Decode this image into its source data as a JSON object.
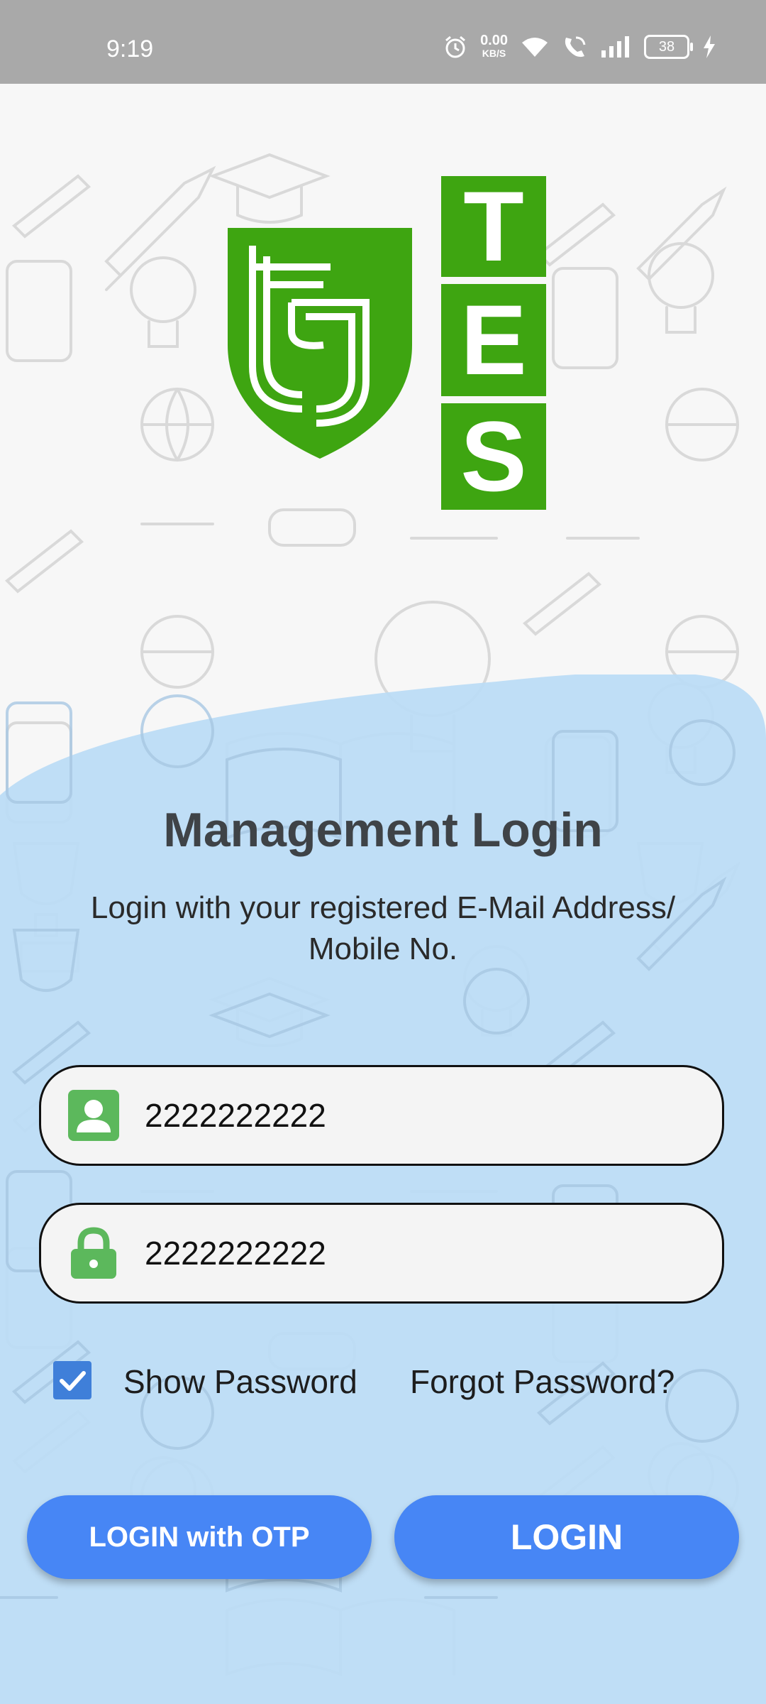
{
  "status_bar": {
    "time": "9:19",
    "net_speed_value": "0.00",
    "net_speed_unit": "KB/S",
    "battery": "38",
    "icons": [
      "alarm-icon",
      "wifi-icon",
      "wifi-call-icon",
      "signal-icon",
      "battery-icon",
      "charging-icon"
    ]
  },
  "logo": {
    "letters": [
      "T",
      "E",
      "S"
    ],
    "color": "#3ea511"
  },
  "login": {
    "title": "Management Login",
    "subtitle_line1": "Login with your registered E-Mail Address/",
    "subtitle_line2": "Mobile No.",
    "username_value": "2222222222",
    "password_value": "2222222222",
    "show_password_label": "Show Password",
    "show_password_checked": true,
    "forgot_password_label": "Forgot Password?",
    "otp_button_label": "LOGIN with OTP",
    "login_button_label": "LOGIN"
  },
  "colors": {
    "panel": "#bcdcf6",
    "button": "#4786f5",
    "icon": "#5cb85c",
    "status_bar": "#a9a9a9"
  }
}
